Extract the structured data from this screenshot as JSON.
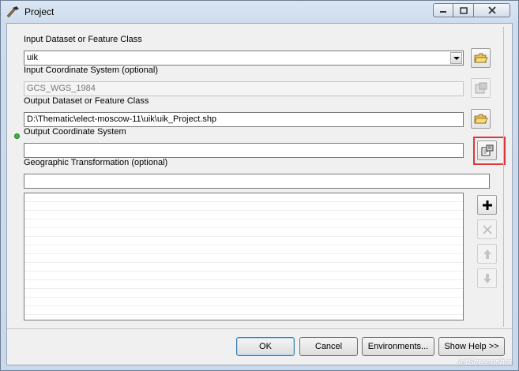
{
  "window": {
    "title": "Project"
  },
  "fields": {
    "input_dataset_label": "Input Dataset or Feature Class",
    "input_dataset_value": "uik",
    "input_cs_label": "Input Coordinate System (optional)",
    "input_cs_value": "GCS_WGS_1984",
    "output_dataset_label": "Output Dataset or Feature Class",
    "output_dataset_value": "D:\\Thematic\\elect-moscow-11\\uik\\uik_Project.shp",
    "output_cs_label": "Output Coordinate System",
    "output_cs_value": "",
    "geo_transform_label": "Geographic Transformation (optional)",
    "geo_transform_value": ""
  },
  "icons": {
    "title": "hammer-icon",
    "browse": "folder-open-icon",
    "cs_properties": "spatial-reference-properties-icon",
    "add": "plus-icon",
    "remove": "x-icon",
    "up": "arrow-up-icon",
    "down": "arrow-down-icon"
  },
  "footer": {
    "ok": "OK",
    "cancel": "Cancel",
    "environments": "Environments...",
    "show_help": "Show Help >>"
  },
  "watermark": "JetScreenshot",
  "colors": {
    "highlight": "#d83a3a",
    "required_dot": "#3fb63f"
  }
}
